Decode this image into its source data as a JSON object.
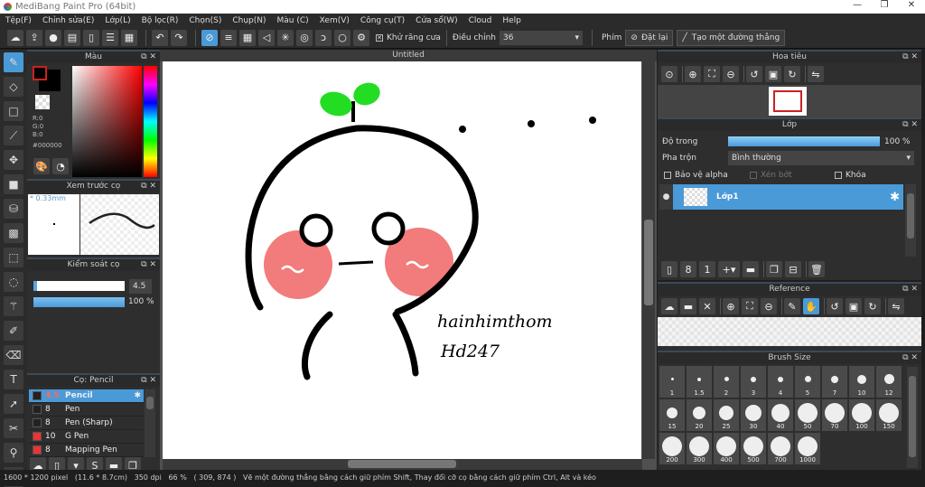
{
  "app": {
    "title": "MediBang Paint Pro (64bit)"
  },
  "window_controls": {
    "minimize": "—",
    "restore": "❐",
    "close": "✕"
  },
  "menu": [
    "Tệp(F)",
    "Chỉnh sửa(E)",
    "Lớp(L)",
    "Bộ lọc(R)",
    "Chọn(S)",
    "Chụp(N)",
    "Màu (C)",
    "Xem(V)",
    "Công cụ(T)",
    "Cửa sổ(W)",
    "Cloud",
    "Help"
  ],
  "toolbar": {
    "antialias_label": "Khử răng cưa",
    "antialias_checked": true,
    "adjust_label": "Điều chỉnh",
    "adjust_value": "36",
    "key_label": "Phím",
    "reset_label": "Đặt lại",
    "straight_line_label": "Tạo một đường thẳng"
  },
  "color_panel": {
    "title": "Màu",
    "r": "R:0",
    "g": "G:0",
    "b": "B:0",
    "hex": "#000000",
    "primary_color": "#000000"
  },
  "brush_preview": {
    "title": "Xem trước cọ",
    "size": "* 0.33mm"
  },
  "brush_control": {
    "title": "Kiểm soát cọ",
    "size_value": "4.5",
    "opacity_value": "100 %",
    "size_fraction": 0.04,
    "opacity_fraction": 1.0
  },
  "brush_list": {
    "title": "Cọ: Pencil",
    "items": [
      {
        "size": "4.5",
        "name": "Pencil",
        "color": "#222222",
        "selected": true
      },
      {
        "size": "8",
        "name": "Pen",
        "color": "#222222",
        "selected": false
      },
      {
        "size": "8",
        "name": "Pen (Sharp)",
        "color": "#222222",
        "selected": false
      },
      {
        "size": "10",
        "name": "G Pen",
        "color": "#ee3333",
        "selected": false
      },
      {
        "size": "8",
        "name": "Mapping Pen",
        "color": "#ee3333",
        "selected": false
      }
    ]
  },
  "document": {
    "tab": "Untitled",
    "signature_line1": "hainhimthom",
    "signature_line2": "Hd247"
  },
  "navigator": {
    "title": "Hoa tiêu"
  },
  "layer_panel": {
    "title": "Lớp",
    "opacity_label": "Độ trong",
    "opacity_value": "100 %",
    "opacity_fraction": 1.0,
    "blend_label": "Pha trộn",
    "blend_value": "Bình thường",
    "protect_alpha": "Bảo vệ alpha",
    "clipping": "Xén bớt",
    "lock": "Khóa",
    "layers": [
      {
        "name": "Lớp1",
        "selected": true
      }
    ]
  },
  "reference": {
    "title": "Reference"
  },
  "brush_size": {
    "title": "Brush Size",
    "sizes": [
      "1",
      "1.5",
      "2",
      "3",
      "4",
      "5",
      "7",
      "10",
      "12",
      "15",
      "20",
      "25",
      "30",
      "40",
      "50",
      "70",
      "100",
      "150",
      "200",
      "300",
      "400",
      "500",
      "700",
      "1000"
    ]
  },
  "status": {
    "dimensions": "1600 * 1200 pixel",
    "physical": "(11.6 * 8.7cm)",
    "dpi": "350 dpi",
    "zoom": "66 %",
    "cursor": "( 309, 874 )",
    "hint": "Vẽ một đường thẳng bằng cách giữ phím Shift, Thay đổi cỡ cọ bằng cách giữ phím Ctrl, Alt và kéo"
  },
  "colors": {
    "accent": "#4a9ad8",
    "cheek": "#f27b7b",
    "sprout": "#22dd22"
  }
}
